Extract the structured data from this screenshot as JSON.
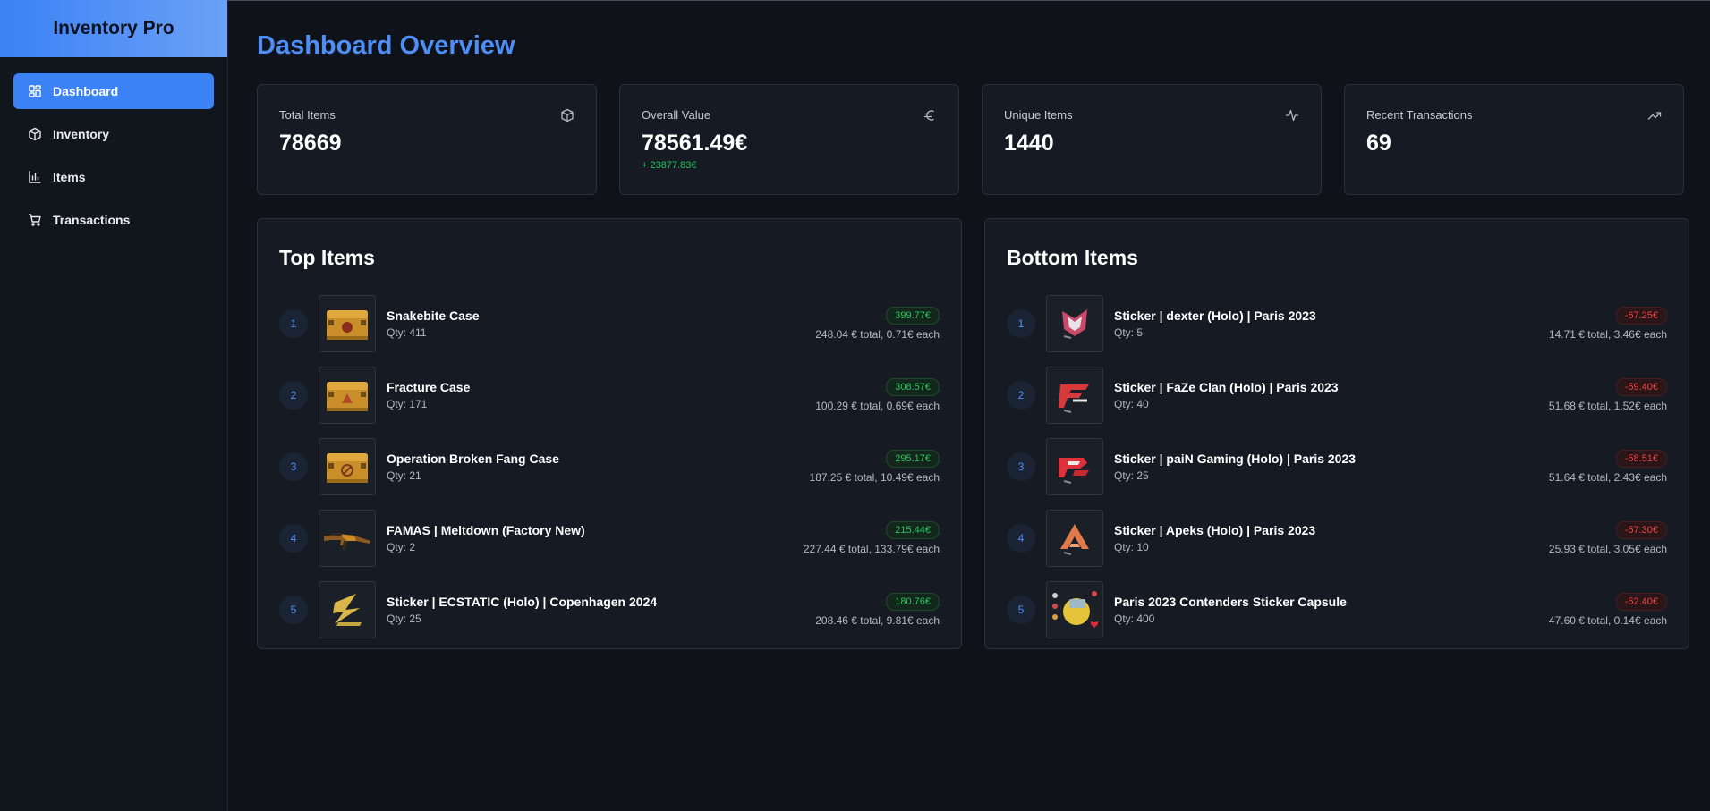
{
  "app": {
    "title": "Inventory Pro"
  },
  "nav": {
    "items": [
      {
        "label": "Dashboard",
        "icon": "dashboard-icon",
        "active": true
      },
      {
        "label": "Inventory",
        "icon": "box-icon"
      },
      {
        "label": "Items",
        "icon": "bar-chart-icon"
      },
      {
        "label": "Transactions",
        "icon": "cart-icon"
      }
    ]
  },
  "page": {
    "title": "Dashboard Overview"
  },
  "stats": [
    {
      "label": "Total Items",
      "value": "78669",
      "icon": "box-icon"
    },
    {
      "label": "Overall Value",
      "value": "78561.49€",
      "sub": "+ 23877.83€",
      "icon": "euro-icon"
    },
    {
      "label": "Unique Items",
      "value": "1440",
      "icon": "activity-icon"
    },
    {
      "label": "Recent Transactions",
      "value": "69",
      "icon": "trending-up-icon"
    }
  ],
  "top": {
    "title": "Top Items",
    "items": [
      {
        "rank": "1",
        "name": "Snakebite Case",
        "qty": "Qty: 411",
        "change": "399.77€",
        "total": "248.04 € total, 0.71€ each",
        "thumb": "case-icon"
      },
      {
        "rank": "2",
        "name": "Fracture Case",
        "qty": "Qty: 171",
        "change": "308.57€",
        "total": "100.29 € total, 0.69€ each",
        "thumb": "case-icon"
      },
      {
        "rank": "3",
        "name": "Operation Broken Fang Case",
        "qty": "Qty: 21",
        "change": "295.17€",
        "total": "187.25 € total, 10.49€ each",
        "thumb": "case-icon"
      },
      {
        "rank": "4",
        "name": "FAMAS | Meltdown (Factory New)",
        "qty": "Qty: 2",
        "change": "215.44€",
        "total": "227.44 € total, 133.79€ each",
        "thumb": "rifle-icon"
      },
      {
        "rank": "5",
        "name": "Sticker | ECSTATIC (Holo) | Copenhagen 2024",
        "qty": "Qty: 25",
        "change": "180.76€",
        "total": "208.46 € total, 9.81€ each",
        "thumb": "sticker-ecstatic-icon"
      }
    ]
  },
  "bottom": {
    "title": "Bottom Items",
    "items": [
      {
        "rank": "1",
        "name": "Sticker | dexter (Holo) | Paris 2023",
        "qty": "Qty: 5",
        "change": "-67.25€",
        "total": "14.71 € total, 3.46€ each",
        "thumb": "sticker-dexter-icon"
      },
      {
        "rank": "2",
        "name": "Sticker | FaZe Clan (Holo) | Paris 2023",
        "qty": "Qty: 40",
        "change": "-59.40€",
        "total": "51.68 € total, 1.52€ each",
        "thumb": "sticker-faze-icon"
      },
      {
        "rank": "3",
        "name": "Sticker | paiN Gaming (Holo) | Paris 2023",
        "qty": "Qty: 25",
        "change": "-58.51€",
        "total": "51.64 € total, 2.43€ each",
        "thumb": "sticker-pain-icon"
      },
      {
        "rank": "4",
        "name": "Sticker | Apeks (Holo) | Paris 2023",
        "qty": "Qty: 10",
        "change": "-57.30€",
        "total": "25.93 € total, 3.05€ each",
        "thumb": "sticker-apeks-icon"
      },
      {
        "rank": "5",
        "name": "Paris 2023 Contenders Sticker Capsule",
        "qty": "Qty: 400",
        "change": "-52.40€",
        "total": "47.60 € total, 0.14€ each",
        "thumb": "capsule-icon"
      }
    ]
  },
  "colors": {
    "accent": "#3b82f6",
    "positive": "#22c55e",
    "negative": "#ef4444",
    "background": "#0f1218",
    "card": "#161a22"
  }
}
